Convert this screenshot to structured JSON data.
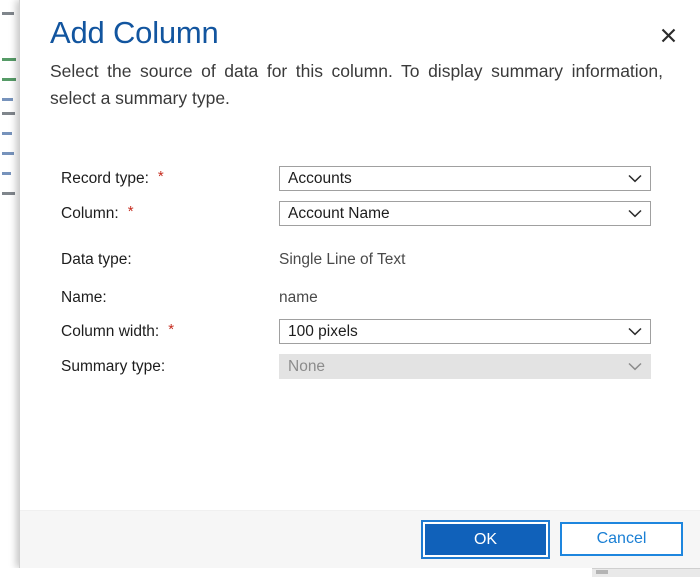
{
  "dialog": {
    "title": "Add Column",
    "description": "Select the source of data for this column. To display summary information, select a summary type.",
    "close_label": "✕"
  },
  "form": {
    "rows": [
      {
        "label": "Record type:",
        "required": "*",
        "control": "dropdown",
        "value": "Accounts",
        "disabled": false
      },
      {
        "label": "Column:",
        "required": "*",
        "control": "dropdown",
        "value": "Account Name",
        "disabled": false
      },
      {
        "label": "Data type:",
        "required": "",
        "control": "static",
        "value": "Single Line of Text",
        "disabled": false
      },
      {
        "label": "Name:",
        "required": "",
        "control": "static",
        "value": "name",
        "disabled": false
      },
      {
        "label": "Column width:",
        "required": "*",
        "control": "dropdown",
        "value": "100 pixels",
        "disabled": false
      },
      {
        "label": "Summary type:",
        "required": "",
        "control": "dropdown",
        "value": "None",
        "disabled": true
      }
    ]
  },
  "footer": {
    "ok_label": "OK",
    "cancel_label": "Cancel"
  },
  "colors": {
    "title_blue": "#12559f",
    "primary_button": "#1061ba",
    "accent_border": "#1e86de",
    "required_red": "#c52b1e",
    "footer_background": "#f6f6f6",
    "disabled_field": "#e3e3e3"
  }
}
